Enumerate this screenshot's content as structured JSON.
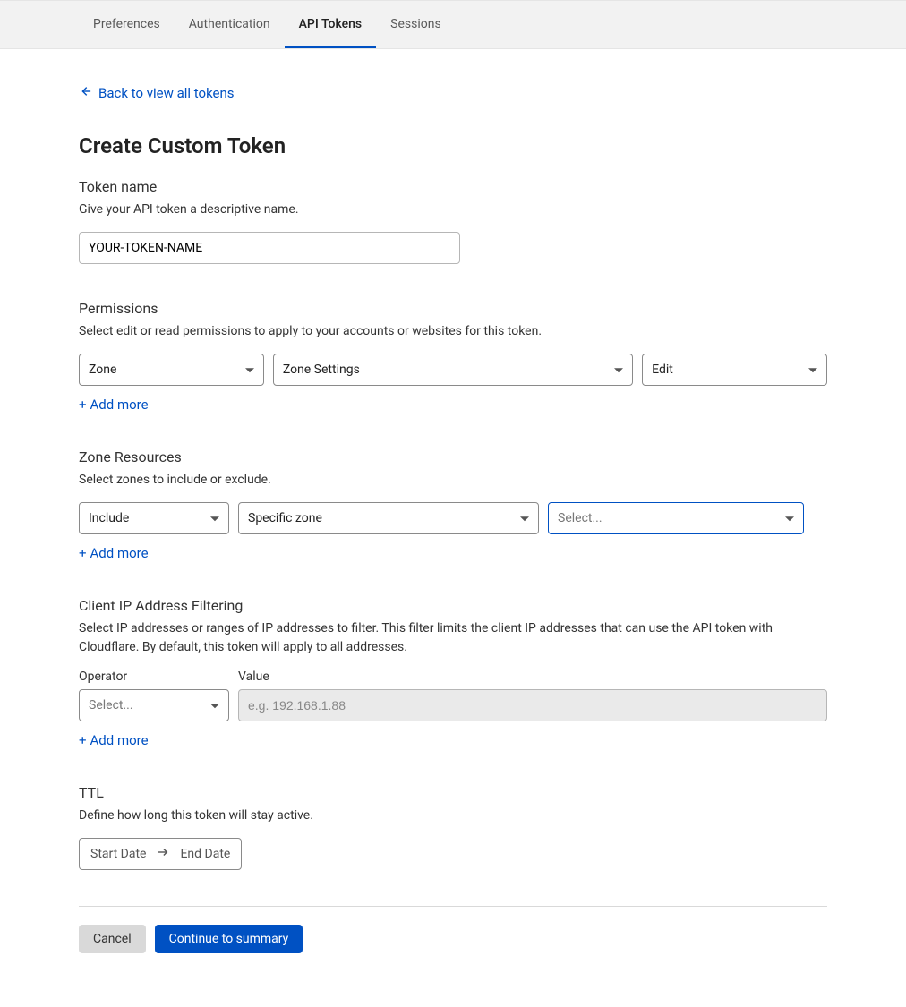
{
  "tabs": {
    "items": [
      {
        "label": "Preferences",
        "active": false
      },
      {
        "label": "Authentication",
        "active": false
      },
      {
        "label": "API Tokens",
        "active": true
      },
      {
        "label": "Sessions",
        "active": false
      }
    ]
  },
  "back_link": "Back to view all tokens",
  "page_title": "Create Custom Token",
  "token_name": {
    "label": "Token name",
    "description": "Give your API token a descriptive name.",
    "value": "YOUR-TOKEN-NAME"
  },
  "permissions": {
    "label": "Permissions",
    "description": "Select edit or read permissions to apply to your accounts or websites for this token.",
    "scope": "Zone",
    "resource": "Zone Settings",
    "access": "Edit",
    "add_more": "Add more"
  },
  "zone_resources": {
    "label": "Zone Resources",
    "description": "Select zones to include or exclude.",
    "mode": "Include",
    "scope": "Specific zone",
    "zone_placeholder": "Select...",
    "add_more": "Add more"
  },
  "ip_filter": {
    "label": "Client IP Address Filtering",
    "description": "Select IP addresses or ranges of IP addresses to filter. This filter limits the client IP addresses that can use the API token with Cloudflare. By default, this token will apply to all addresses.",
    "operator_label": "Operator",
    "value_label": "Value",
    "operator_placeholder": "Select...",
    "value_placeholder": "e.g. 192.168.1.88",
    "add_more": "Add more"
  },
  "ttl": {
    "label": "TTL",
    "description": "Define how long this token will stay active.",
    "start": "Start Date",
    "end": "End Date"
  },
  "buttons": {
    "cancel": "Cancel",
    "continue": "Continue to summary"
  },
  "plus_glyph": "+"
}
